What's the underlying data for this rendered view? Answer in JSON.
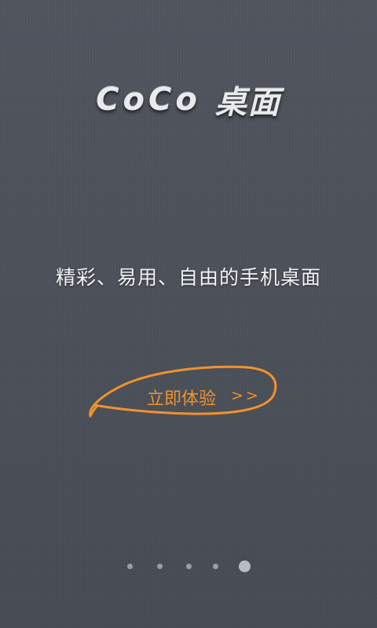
{
  "logo": {
    "latin": "CoCo",
    "cjk": "桌面"
  },
  "tagline": "精彩、易用、自由的手机桌面",
  "cta": {
    "label": "立即体验",
    "arrows": ">>",
    "color": "#f0922e"
  },
  "pager": {
    "total": 5,
    "active_index": 4
  }
}
